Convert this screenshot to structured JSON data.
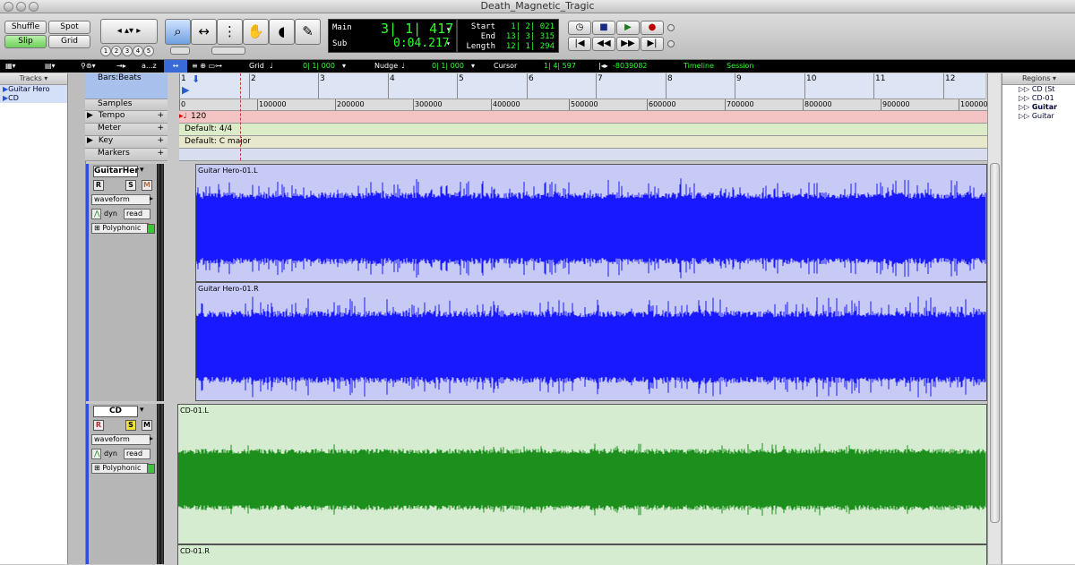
{
  "window": {
    "title": "Death_Magnetic_Tragic"
  },
  "toolbar": {
    "modes": {
      "shuffle": "Shuffle",
      "spot": "Spot",
      "slip": "Slip",
      "grid": "Grid"
    },
    "zoom_presets": [
      "1",
      "2",
      "3",
      "4",
      "5"
    ],
    "counter": {
      "main_label": "Main",
      "main_value": "3| 1| 417",
      "sub_label": "Sub",
      "sub_value": "0:04.217",
      "start_label": "Start",
      "start_value": "1| 2| 021",
      "end_label": "End",
      "end_value": "13| 3| 315",
      "length_label": "Length",
      "length_value": "12| 1| 294"
    }
  },
  "edit_strip": {
    "text_tool": "a...z",
    "grid_label": "Grid",
    "grid_value": "0| 1| 000",
    "nudge_label": "Nudge",
    "nudge_value": "0| 1| 000",
    "cursor_label": "Cursor",
    "cursor_value": "1| 4| 597",
    "cursor_samples": "-8039082",
    "timeline_label": "Timeline",
    "session_label": "Session"
  },
  "tracks_list": {
    "header": "Tracks",
    "items": [
      "Guitar Hero",
      "CD"
    ]
  },
  "rulers": {
    "bars_beats_label": "Bars:Beats",
    "bars": [
      "1",
      "2",
      "3",
      "4",
      "5",
      "6",
      "7",
      "8",
      "9",
      "10",
      "11",
      "12"
    ],
    "samples_label": "Samples",
    "samples": [
      "0",
      "100000",
      "200000",
      "300000",
      "400000",
      "500000",
      "600000",
      "700000",
      "800000",
      "900000",
      "100000"
    ],
    "tempo_label": "Tempo",
    "tempo_value": "120",
    "meter_label": "Meter",
    "meter_value": "Default: 4/4",
    "key_label": "Key",
    "key_value": "Default: C major",
    "markers_label": "Markers"
  },
  "tracks": [
    {
      "name": "GuitarHer",
      "record": "R",
      "solo": "S",
      "mute": "M",
      "view": "waveform",
      "auto": "dyn",
      "auto_mode": "read",
      "elastic": "Polyphonic",
      "regions": [
        "Guitar Hero-01.L",
        "Guitar Hero-01.R"
      ],
      "bg": "#c8caf6",
      "wave_color": "#1919ff"
    },
    {
      "name": "CD",
      "record": "R",
      "solo": "S",
      "mute": "M",
      "view": "waveform",
      "auto": "dyn",
      "auto_mode": "read",
      "elastic": "Polyphonic",
      "regions": [
        "CD-01.L",
        "CD-01.R"
      ],
      "bg": "#d5ecd1",
      "wave_color": "#1c8f1c"
    }
  ],
  "regions_list": {
    "header": "Regions",
    "items": [
      "CD (St",
      "CD-01",
      "Guitar",
      "Guitar"
    ]
  },
  "colors": {
    "tempo_bg": "#f4c4c4",
    "meter_bg": "#dcebc8",
    "counter_text": "#2cff2c"
  }
}
